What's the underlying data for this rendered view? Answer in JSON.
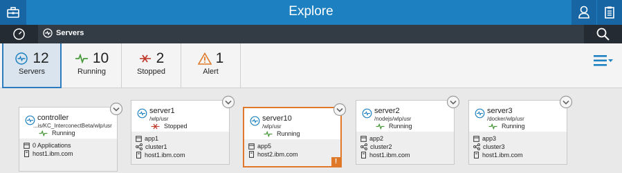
{
  "header": {
    "title": "Explore"
  },
  "breadcrumb": {
    "label": "Servers"
  },
  "summary": [
    {
      "key": "servers",
      "count": "12",
      "label": "Servers",
      "icon": "server-icon",
      "active": true
    },
    {
      "key": "running",
      "count": "10",
      "label": "Running",
      "icon": "running-pulse-icon"
    },
    {
      "key": "stopped",
      "count": "2",
      "label": "Stopped",
      "icon": "stopped-icon"
    },
    {
      "key": "alert",
      "count": "1",
      "label": "Alert",
      "icon": "alert-triangle-icon"
    }
  ],
  "colors": {
    "brand": "#1c80c1",
    "running": "#4a9a3c",
    "stopped": "#c0392b",
    "alert": "#e0782a",
    "subbar": "#333c45"
  },
  "cards": [
    {
      "name": "controller",
      "path": "...is/KC_InterconectBeta/wlp/usr",
      "status": "Running",
      "line1": "0 Applications",
      "line2": "",
      "host": "host1.ibm.com"
    },
    {
      "name": "server1",
      "path": "/wlp/usr",
      "status": "Stopped",
      "line1": "app1",
      "line2": "cluster1",
      "host": "host1.ibm.com"
    },
    {
      "name": "server10",
      "path": "/wlp/usr",
      "status": "Running",
      "line1": "app5",
      "line2": "",
      "host": "host2.ibm.com"
    },
    {
      "name": "server2",
      "path": "/nodejs/wlp/usr",
      "status": "Running",
      "line1": "app2",
      "line2": "cluster2",
      "host": "host1.ibm.com"
    },
    {
      "name": "server3",
      "path": "/docker/wlp/usr",
      "status": "Running",
      "line1": "app3",
      "line2": "cluster3",
      "host": "host1.ibm.com"
    }
  ],
  "alert_badge": "!"
}
